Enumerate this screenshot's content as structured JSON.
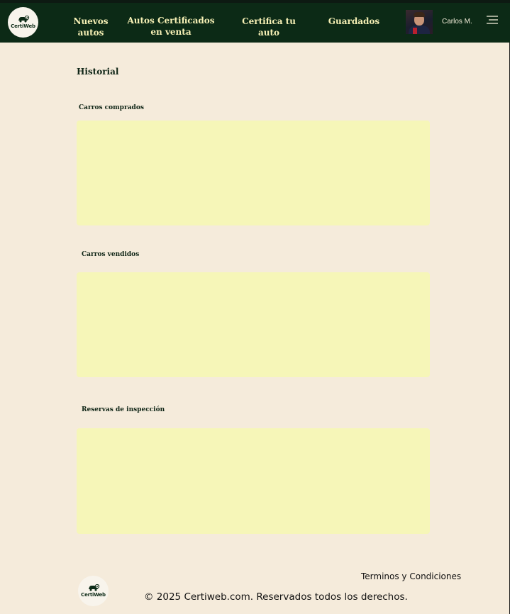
{
  "brand": {
    "logo_text": "CertiWeb"
  },
  "nav": {
    "links": [
      {
        "label": "Nuevos autos"
      },
      {
        "label": "Autos Certificados en venta"
      },
      {
        "label": "Certifica tu auto"
      },
      {
        "label": "Guardados"
      }
    ],
    "user_name": "Carlos M.",
    "menu_icon": "hamburger-menu-icon"
  },
  "main": {
    "title": "Historial",
    "sections": [
      {
        "label": "Carros comprados"
      },
      {
        "label": "Carros vendidos"
      },
      {
        "label": "Reservas de inspección"
      }
    ]
  },
  "footer": {
    "terms_label": "Terminos y Condiciones",
    "copyright": "© 2025 Certiweb.com. Reservados todos los derechos.",
    "logo_text": "CertiWeb"
  },
  "colors": {
    "navbar_bg": "#0c2a16",
    "nav_text": "#f6f0b5",
    "page_bg": "#f5ebdb",
    "panel_bg": "#f6f6b8"
  }
}
